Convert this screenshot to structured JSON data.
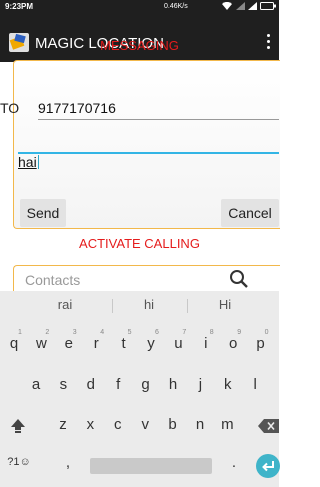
{
  "status_bar": {
    "time": "9:23PM",
    "speed": "0.46K/s",
    "icons": "wifi-icon signal-icon battery-icon"
  },
  "app_bar": {
    "title": "MAGIC LOCATION",
    "logo_icon": "app-logo-icon",
    "menu_icon": "overflow-menu-icon"
  },
  "messaging": {
    "section_label": "MESSAGING",
    "to_label": "TO",
    "phone_number": "9177170716",
    "message": "hai",
    "send_label": "Send",
    "cancel_label": "Cancel"
  },
  "calling": {
    "section_label": "ACTIVATE CALLING",
    "contacts_placeholder": "Contacts",
    "search_icon": "search-icon"
  },
  "keyboard": {
    "suggestions": [
      "rai",
      "hi",
      "Hi"
    ],
    "row1": [
      "q",
      "w",
      "e",
      "r",
      "t",
      "y",
      "u",
      "i",
      "o",
      "p"
    ],
    "row1_hints": [
      "1",
      "2",
      "3",
      "4",
      "5",
      "6",
      "7",
      "8",
      "9",
      "0"
    ],
    "row2": [
      "a",
      "s",
      "d",
      "f",
      "g",
      "h",
      "j",
      "k",
      "l"
    ],
    "row3": [
      "z",
      "x",
      "c",
      "v",
      "b",
      "n",
      "m"
    ],
    "symbols_label": "?1☺",
    "comma": ",",
    "period": ".",
    "shift_icon": "shift-icon",
    "backspace_icon": "backspace-icon",
    "enter_icon": "enter-icon",
    "accent_color": "#3fb4c9"
  },
  "colors": {
    "section_label": "#e51c1c",
    "panel_border": "#f2b84b",
    "focus_line": "#33b5e5"
  }
}
